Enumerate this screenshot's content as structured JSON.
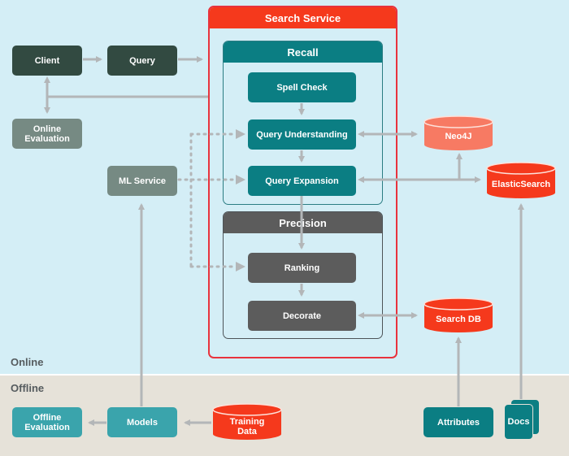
{
  "zones": {
    "online_label": "Online",
    "offline_label": "Offline"
  },
  "online_nodes": {
    "client": "Client",
    "query": "Query",
    "online_evaluation": "Online\nEvaluation",
    "ml_service": "ML Service"
  },
  "search_service": {
    "title": "Search Service",
    "recall": {
      "title": "Recall",
      "steps": [
        "Spell Check",
        "Query Understanding",
        "Query Expansion"
      ]
    },
    "precision": {
      "title": "Precision",
      "steps": [
        "Ranking",
        "Decorate"
      ]
    }
  },
  "datastores": {
    "neo4j": "Neo4J",
    "elasticsearch": "ElasticSearch",
    "search_db": "Search DB",
    "training_data": "Training\nData"
  },
  "offline_nodes": {
    "offline_evaluation": "Offline\nEvaluation",
    "models": "Models",
    "attributes": "Attributes",
    "docs": "Docs"
  },
  "colors": {
    "online_bg": "#d4eef6",
    "offline_bg": "#e6e2d9",
    "search_service_red": "#f5391c",
    "recall_teal": "#0b7e83",
    "precision_grey": "#5c5c5c",
    "client_dark": "#324a41",
    "neo4j_salmon": "#f77a63",
    "arrow_grey": "#b3b6b8"
  }
}
